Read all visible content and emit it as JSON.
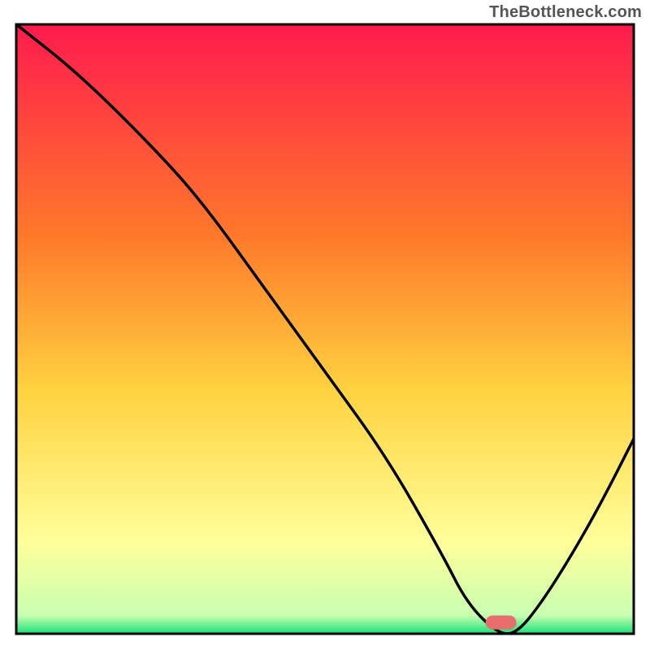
{
  "watermark": "TheBottleneck.com",
  "colors": {
    "gradient_top": "#ff1a4d",
    "gradient_mid1": "#ff7a2a",
    "gradient_mid2": "#ffd23f",
    "gradient_mid3": "#ffff9a",
    "gradient_bottom": "#18e07a",
    "line": "#000000",
    "marker": "#e86d6d",
    "frame": "#000000"
  },
  "chart_data": {
    "type": "line",
    "title": "",
    "xlabel": "",
    "ylabel": "",
    "xlim": [
      0,
      100
    ],
    "ylim": [
      0,
      100
    ],
    "grid": false,
    "series": [
      {
        "name": "curve",
        "x": [
          0,
          10,
          22,
          30,
          40,
          50,
          60,
          69,
          73,
          78,
          81,
          85,
          90,
          95,
          100
        ],
        "y": [
          100,
          92,
          80,
          71,
          57,
          43,
          29,
          13,
          5,
          0,
          0,
          5,
          13,
          22,
          32
        ]
      }
    ],
    "annotations": [
      {
        "name": "marker",
        "type": "rounded_bar",
        "x_start": 76,
        "x_end": 81,
        "y": 0.7,
        "height": 2.3,
        "color": "#e86d6d"
      }
    ],
    "note": "x and y are on 0-100 normalized axes; y=0 is green band at bottom, y=100 is red at top."
  }
}
